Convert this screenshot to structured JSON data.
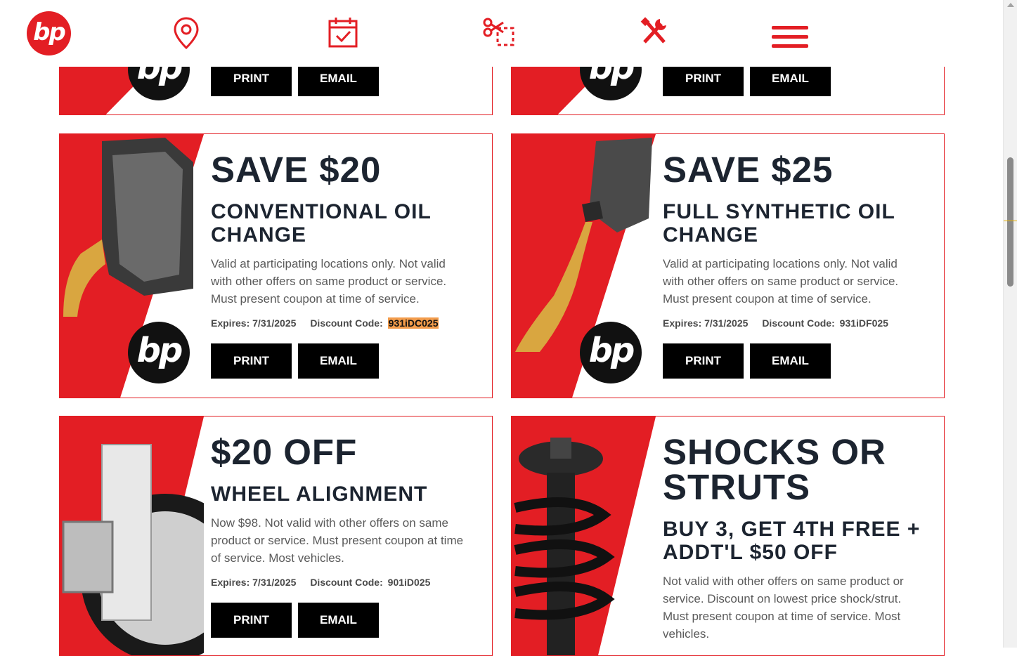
{
  "header": {
    "logo_text": "bp",
    "nav_icons": [
      "location-pin-icon",
      "calendar-check-icon",
      "coupon-scissors-icon",
      "tools-icon",
      "hamburger-menu-icon"
    ]
  },
  "buttons": {
    "print": "PRINT",
    "email": "EMAIL"
  },
  "colors": {
    "brand_red": "#e31e24",
    "heading": "#1c2430",
    "highlight": "#f39c4b"
  },
  "coupons": [
    {
      "headline": "SAVE $20",
      "subhead": "CONVENTIONAL OIL CHANGE",
      "description": "Valid at participating locations only. Not valid with other offers on same product or service. Must present coupon at time of service.",
      "expires": "Expires: 7/31/2025",
      "code_label": "Discount Code:",
      "code": "931iDC025"
    },
    {
      "headline": "SAVE $25",
      "subhead": "FULL SYNTHETIC OIL CHANGE",
      "description": "Valid at participating locations only. Not valid with other offers on same product or service. Must present coupon at time of service.",
      "expires": "Expires: 7/31/2025",
      "code_label": "Discount Code:",
      "code": "931iDF025"
    },
    {
      "headline": "$20 OFF",
      "subhead": "WHEEL ALIGNMENT",
      "description": "Now $98. Not valid with other offers on same product or service. Must present coupon at time of service. Most vehicles.",
      "expires": "Expires: 7/31/2025",
      "code_label": "Discount Code:",
      "code": "901iD025"
    },
    {
      "headline": "SHOCKS OR STRUTS",
      "subhead": "BUY 3, GET 4TH FREE + ADDT'L $50 OFF",
      "description": "Not valid with other offers on same product or service. Discount on lowest price shock/strut. Must present coupon at time of service. Most vehicles."
    }
  ]
}
